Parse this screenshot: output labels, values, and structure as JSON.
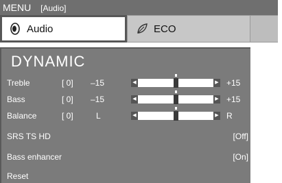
{
  "header": {
    "title": "MENU",
    "subtitle": "[Audio]"
  },
  "tabs": [
    {
      "label": "Audio",
      "icon": "speaker-icon",
      "active": true
    },
    {
      "label": "ECO",
      "icon": "leaf-icon",
      "active": false
    }
  ],
  "panel": {
    "preset": "DYNAMIC",
    "sliders": [
      {
        "label": "Treble",
        "value": "[ 0]",
        "min": "–15",
        "max": "+15",
        "position": 0.5
      },
      {
        "label": "Bass",
        "value": "[ 0]",
        "min": "–15",
        "max": "+15",
        "position": 0.5
      },
      {
        "label": "Balance",
        "value": "[ 0]",
        "min": "L",
        "max": "R",
        "position": 0.5
      }
    ],
    "items": [
      {
        "label": "SRS TS HD",
        "value": "[Off]"
      },
      {
        "label": "Bass enhancer",
        "value": "[On]"
      },
      {
        "label": "Reset",
        "value": ""
      }
    ]
  }
}
